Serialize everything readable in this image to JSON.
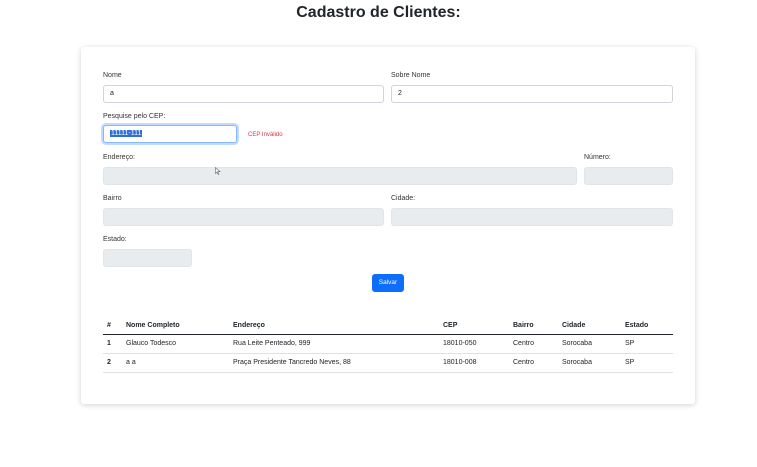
{
  "page": {
    "title": "Cadastro de Clientes:"
  },
  "form": {
    "nome_label": "Nome",
    "nome_value": "a",
    "sobrenome_label": "Sobre Nome",
    "sobrenome_value": "2",
    "cep_label": "Pesquise pelo CEP:",
    "cep_value": "11111-111",
    "cep_error": "CEP Inválido",
    "endereco_label": "Endereço:",
    "endereco_value": "",
    "numero_label": "Número:",
    "numero_value": "",
    "bairro_label": "Bairro",
    "bairro_value": "",
    "cidade_label": "Cidade:",
    "cidade_value": "",
    "estado_label": "Estado:",
    "estado_value": "",
    "save_label": "Salvar"
  },
  "table": {
    "headers": [
      "#",
      "Nome Completo",
      "Endereço",
      "CEP",
      "Bairro",
      "Cidade",
      "Estado"
    ],
    "rows": [
      [
        "1",
        "Glauco Todesco",
        "Rua Leite Penteado, 999",
        "18010-050",
        "Centro",
        "Sorocaba",
        "SP"
      ],
      [
        "2",
        "a a",
        "Praça Presidente Tancredo Neves, 88",
        "18010-008",
        "Centro",
        "Sorocaba",
        "SP"
      ]
    ]
  },
  "colors": {
    "primary": "#0d6efd",
    "danger": "#dc3545",
    "disabled_bg": "#e9ecef"
  }
}
